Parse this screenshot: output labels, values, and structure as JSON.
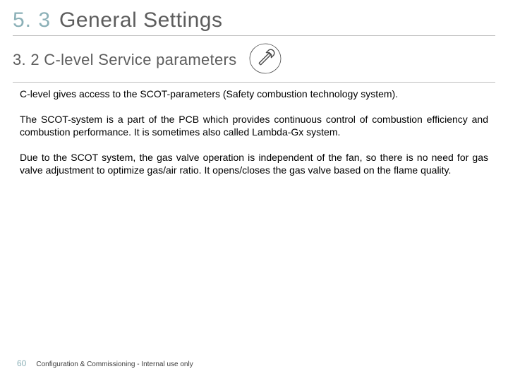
{
  "chapter": {
    "number": "5. 3",
    "title": "General Settings"
  },
  "subsection": {
    "title": "3. 2 C-level Service parameters"
  },
  "icon": {
    "name": "wrench-icon"
  },
  "paragraphs": {
    "p1": "C-level gives access to the SCOT-parameters (Safety combustion technology system).",
    "p2": "The SCOT-system is a part of the PCB which provides continuous control of combustion efficiency and combustion performance. It is sometimes also called Lambda-Gx system.",
    "p3": "Due to the SCOT system, the gas valve operation is independent of the fan, so there is no need for gas valve adjustment to optimize gas/air ratio. It opens/closes the gas valve based on the flame quality."
  },
  "footer": {
    "page": "60",
    "text": "Configuration & Commissioning - Internal use only"
  }
}
